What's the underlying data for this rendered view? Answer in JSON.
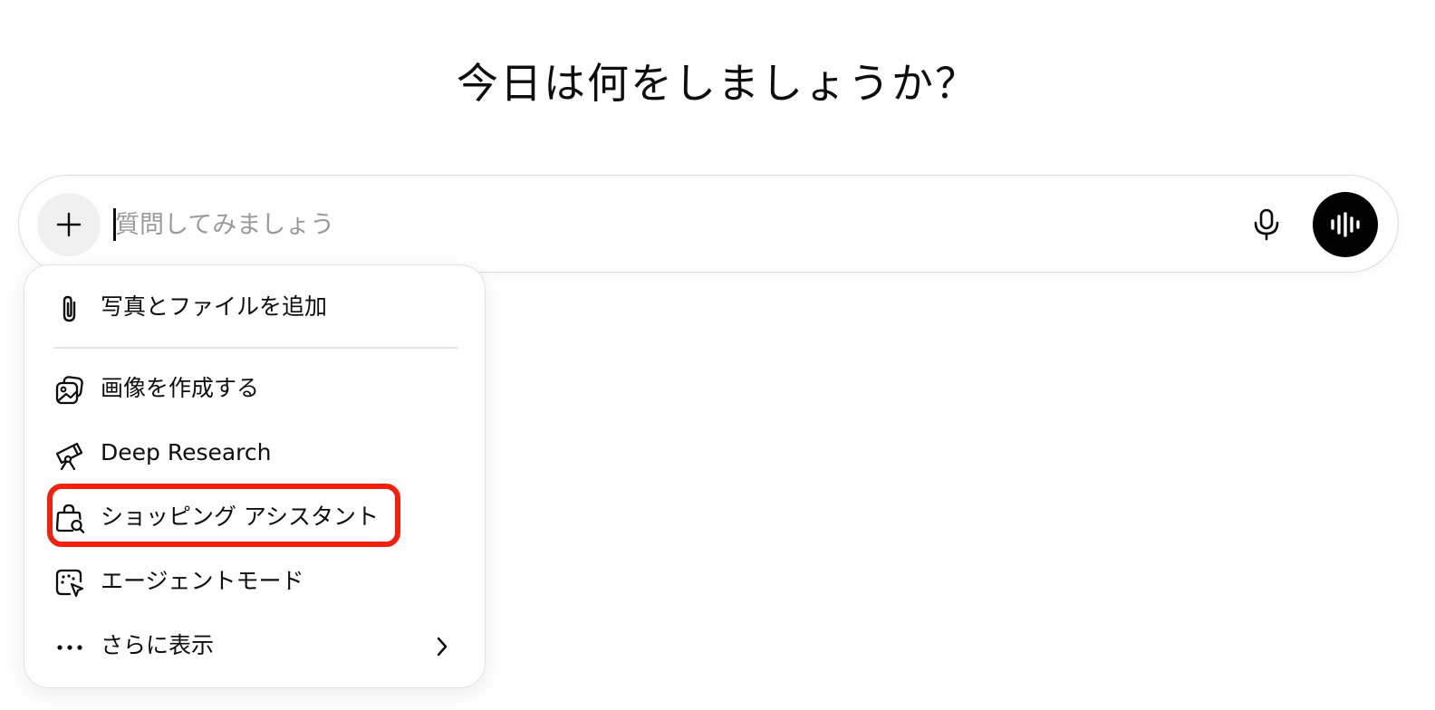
{
  "headline": "今日は何をしましょうか？",
  "composer": {
    "placeholder": "質問してみましょう",
    "value": "",
    "plus_icon": "plus-icon",
    "mic_icon": "microphone-icon",
    "voice_icon": "voice-waveform-icon"
  },
  "menu": {
    "items": [
      {
        "label": "写真とファイルを追加",
        "icon": "paperclip-icon"
      },
      {
        "label": "画像を作成する",
        "icon": "image-create-icon"
      },
      {
        "label": "Deep Research",
        "icon": "telescope-icon"
      },
      {
        "label": "ショッピング アシスタント",
        "icon": "shopping-bag-search-icon",
        "highlighted": true
      },
      {
        "label": "エージェントモード",
        "icon": "agent-cursor-icon"
      },
      {
        "label": "さらに表示",
        "icon": "more-dots-icon",
        "submenu_icon": "chevron-right-icon"
      }
    ]
  },
  "colors": {
    "highlight": "#f2200f",
    "voice_button": "#000000",
    "plus_button_bg": "#f0f0f0",
    "placeholder": "#9a9a9a"
  }
}
